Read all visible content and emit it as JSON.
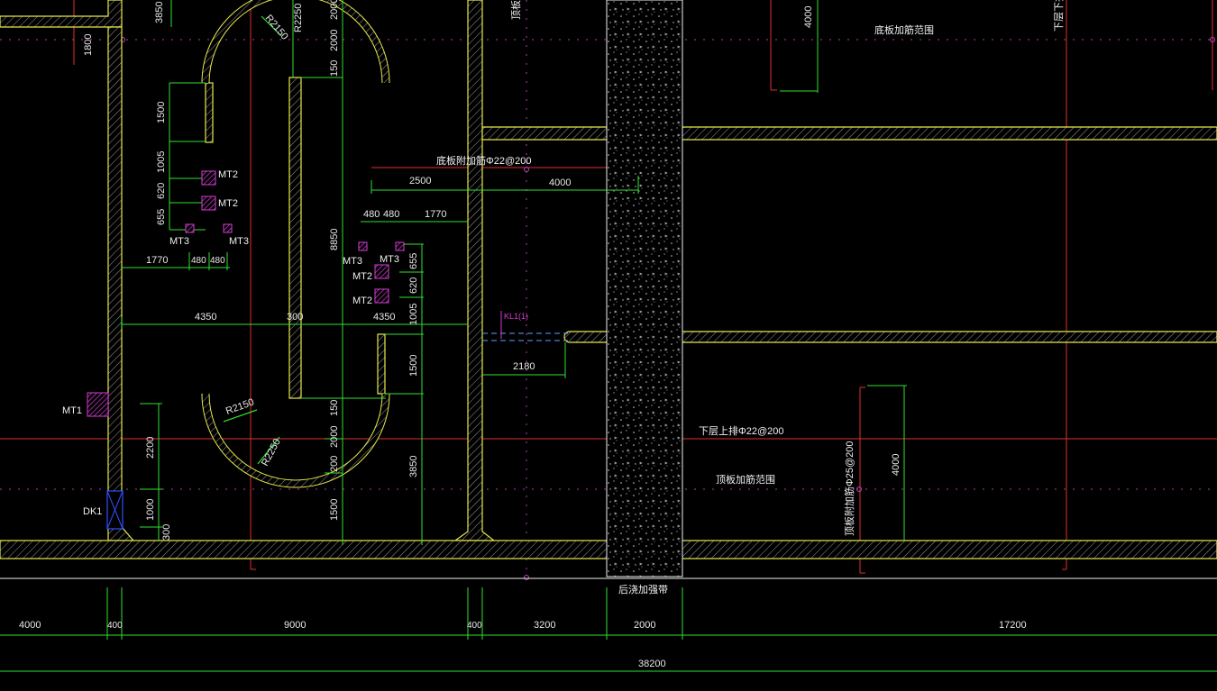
{
  "colors": {
    "background": "#000000",
    "wall_outline": "#e8e84a",
    "hatch": "#bdbdbd",
    "dimension_line": "#2fe02f",
    "axis_line": "#e03030",
    "center_dot": "#c040c0",
    "text": "#e8e8e8",
    "component": "#d83cd8",
    "opening": "#3050ff"
  },
  "labels": {
    "bottom_reinforce_range": "底板加筋范围",
    "top_reinforce_range": "顶板加筋范围",
    "bottom_bars": "底板附加筋Φ22@200",
    "lower_top_bars": "下层上排Φ22@200",
    "top_bars_side": "顶板附加筋Φ25@200",
    "joint_strip": "后浇加强带",
    "next_layer_top": "下层下排",
    "beam_kl": "KL1(1)",
    "beam_top": "顶板",
    "mt1": "MT1",
    "mt2_a": "MT2",
    "mt2_b": "MT2",
    "mt2_c": "MT2",
    "mt2_d": "MT2",
    "mt3_a": "MT3",
    "mt3_b": "MT3",
    "mt3_c": "MT3",
    "mt3_d": "MT3",
    "dk1": "DK1"
  },
  "dims": {
    "d3850_top": "3850",
    "d1800": "1800",
    "d2000_a": "2000",
    "d2000_b": "2000",
    "r2250_top": "R2250",
    "r2150_top": "R2150",
    "d150_top": "150",
    "d1500_left": "1500",
    "d1005_left": "1005",
    "d620_left": "620",
    "d655_left": "655",
    "d1770_left": "1770",
    "d480_l1": "480",
    "d480_l2": "480",
    "d8850": "8850",
    "d2500": "2500",
    "d4000_mid": "4000",
    "d480_r1": "480",
    "d480_r2": "480",
    "d1770_right": "1770",
    "d655_right": "655",
    "d620_right": "620",
    "d1005_right": "1005",
    "d4350_left": "4350",
    "d300_mid": "300",
    "d4350_right": "4350",
    "d1500_right": "1500",
    "d2180": "2180",
    "d4000_top_right": "4000",
    "d4000_bottom_right": "4000",
    "r2150_bot": "R2150",
    "r2250_bot": "R2250",
    "d150_bot": "150",
    "d2000_bot": "2000",
    "d200_bot": "200",
    "d1500_bot": "1500",
    "d3850_bot": "3850",
    "d2200": "2200",
    "d1000": "1000",
    "d300_bot": "300"
  },
  "bottom_dims": {
    "seg_4000": "4000",
    "seg_400a": "400",
    "seg_9000": "9000",
    "seg_400b": "400",
    "seg_3200": "3200",
    "seg_2000": "2000",
    "seg_17200": "17200",
    "total_38200": "38200"
  }
}
